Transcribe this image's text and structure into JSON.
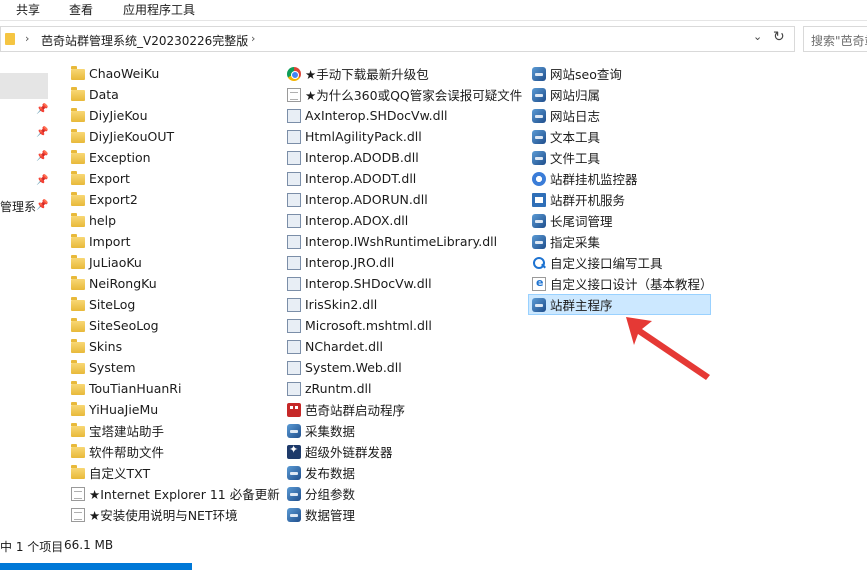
{
  "ribbon": {
    "tabs": [
      "共享",
      "查看",
      "应用程序工具"
    ]
  },
  "address": {
    "path": "芭奇站群管理系统_V20230226完整版",
    "search_placeholder": "搜索\"芭奇站"
  },
  "nav": {
    "partial_label": "管理系"
  },
  "columns": [
    [
      {
        "label": "ChaoWeiKu",
        "icon": "folder-icon"
      },
      {
        "label": "Data",
        "icon": "folder-icon"
      },
      {
        "label": "DiyJieKou",
        "icon": "folder-icon"
      },
      {
        "label": "DiyJieKouOUT",
        "icon": "folder-icon"
      },
      {
        "label": "Exception",
        "icon": "folder-icon"
      },
      {
        "label": "Export",
        "icon": "folder-icon"
      },
      {
        "label": "Export2",
        "icon": "folder-icon"
      },
      {
        "label": "help",
        "icon": "folder-icon"
      },
      {
        "label": "Import",
        "icon": "folder-icon"
      },
      {
        "label": "JuLiaoKu",
        "icon": "folder-icon"
      },
      {
        "label": "NeiRongKu",
        "icon": "folder-icon"
      },
      {
        "label": "SiteLog",
        "icon": "folder-icon"
      },
      {
        "label": "SiteSeoLog",
        "icon": "folder-icon"
      },
      {
        "label": "Skins",
        "icon": "folder-icon"
      },
      {
        "label": "System",
        "icon": "folder-icon"
      },
      {
        "label": "TouTianHuanRi",
        "icon": "folder-icon"
      },
      {
        "label": "YiHuaJieMu",
        "icon": "folder-icon"
      },
      {
        "label": "宝塔建站助手",
        "icon": "folder-icon"
      },
      {
        "label": "软件帮助文件",
        "icon": "folder-icon"
      },
      {
        "label": "自定义TXT",
        "icon": "folder-icon"
      },
      {
        "label": "★Internet Explorer 11 必备更新",
        "icon": "document-icon"
      },
      {
        "label": "★安装使用说明与NET环境",
        "icon": "document-icon"
      }
    ],
    [
      {
        "label": "★手动下载最新升级包",
        "icon": "chrome-icon"
      },
      {
        "label": "★为什么360或QQ管家会误报可疑文件",
        "icon": "document-icon"
      },
      {
        "label": "AxInterop.SHDocVw.dll",
        "icon": "dll-icon"
      },
      {
        "label": "HtmlAgilityPack.dll",
        "icon": "dll-icon"
      },
      {
        "label": "Interop.ADODB.dll",
        "icon": "dll-icon"
      },
      {
        "label": "Interop.ADODT.dll",
        "icon": "dll-icon"
      },
      {
        "label": "Interop.ADORUN.dll",
        "icon": "dll-icon"
      },
      {
        "label": "Interop.ADOX.dll",
        "icon": "dll-icon"
      },
      {
        "label": "Interop.IWshRuntimeLibrary.dll",
        "icon": "dll-icon"
      },
      {
        "label": "Interop.JRO.dll",
        "icon": "dll-icon"
      },
      {
        "label": "Interop.SHDocVw.dll",
        "icon": "dll-icon"
      },
      {
        "label": "IrisSkin2.dll",
        "icon": "dll-icon"
      },
      {
        "label": "Microsoft.mshtml.dll",
        "icon": "dll-icon"
      },
      {
        "label": "NChardet.dll",
        "icon": "dll-icon"
      },
      {
        "label": "System.Web.dll",
        "icon": "dll-icon"
      },
      {
        "label": "zRuntm.dll",
        "icon": "dll-icon"
      },
      {
        "label": "芭奇站群启动程序",
        "icon": "launcher-icon"
      },
      {
        "label": "采集数据",
        "icon": "app-icon"
      },
      {
        "label": "超级外链群发器",
        "icon": "star-icon"
      },
      {
        "label": "发布数据",
        "icon": "app-icon"
      },
      {
        "label": "分组参数",
        "icon": "app-icon"
      },
      {
        "label": "数据管理",
        "icon": "app-icon"
      }
    ],
    [
      {
        "label": "网站seo查询",
        "icon": "app-icon"
      },
      {
        "label": "网站归属",
        "icon": "app-icon"
      },
      {
        "label": "网站日志",
        "icon": "app-icon"
      },
      {
        "label": "文本工具",
        "icon": "app-icon"
      },
      {
        "label": "文件工具",
        "icon": "app-icon"
      },
      {
        "label": "站群挂机监控器",
        "icon": "gear-icon"
      },
      {
        "label": "站群开机服务",
        "icon": "blue-window-icon"
      },
      {
        "label": "长尾词管理",
        "icon": "app-icon"
      },
      {
        "label": "指定采集",
        "icon": "app-icon"
      },
      {
        "label": "自定义接口编写工具",
        "icon": "magnifier-icon"
      },
      {
        "label": "自定义接口设计（基本教程）",
        "icon": "ie-document-icon"
      },
      {
        "label": "站群主程序",
        "icon": "app-icon",
        "selected": true
      }
    ]
  ],
  "status": {
    "selection": "中 1 个项目",
    "size": "66.1 MB"
  },
  "colors": {
    "selection_bg": "#cce8ff",
    "selection_border": "#99d1ff",
    "arrow": "#e53935",
    "accent": "#0078d7"
  }
}
